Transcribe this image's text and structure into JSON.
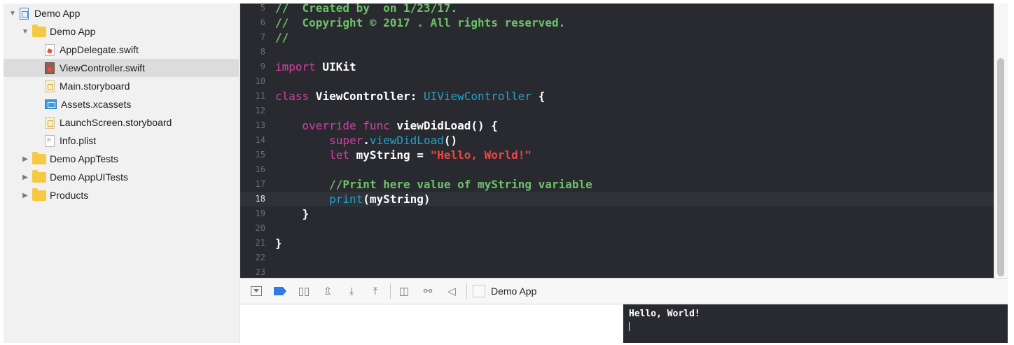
{
  "navigator": {
    "items": [
      {
        "label": "Demo App",
        "kind": "project",
        "disclosure": "▼",
        "indent": 0
      },
      {
        "label": "Demo App",
        "kind": "folder",
        "disclosure": "▼",
        "indent": 1
      },
      {
        "label": "AppDelegate.swift",
        "kind": "swift",
        "disclosure": "",
        "indent": 2
      },
      {
        "label": "ViewController.swift",
        "kind": "swift-selected",
        "disclosure": "",
        "indent": 2
      },
      {
        "label": "Main.storyboard",
        "kind": "storyboard",
        "disclosure": "",
        "indent": 2
      },
      {
        "label": "Assets.xcassets",
        "kind": "assets",
        "disclosure": "",
        "indent": 2
      },
      {
        "label": "LaunchScreen.storyboard",
        "kind": "storyboard",
        "disclosure": "",
        "indent": 2
      },
      {
        "label": "Info.plist",
        "kind": "plist",
        "disclosure": "",
        "indent": 2
      },
      {
        "label": "Demo AppTests",
        "kind": "folder",
        "disclosure": "▶",
        "indent": 1
      },
      {
        "label": "Demo AppUITests",
        "kind": "folder",
        "disclosure": "▶",
        "indent": 1
      },
      {
        "label": "Products",
        "kind": "folder",
        "disclosure": "▶",
        "indent": 1
      }
    ],
    "selected_label": "ViewController.swift"
  },
  "editor": {
    "current_line": "18",
    "lines": [
      {
        "num": "5",
        "tokens": [
          {
            "t": "//  Created by  on 1/23/17.",
            "c": "comment"
          }
        ]
      },
      {
        "num": "6",
        "tokens": [
          {
            "t": "//  Copyright © 2017 . All rights reserved.",
            "c": "comment"
          }
        ]
      },
      {
        "num": "7",
        "tokens": [
          {
            "t": "//",
            "c": "comment"
          }
        ]
      },
      {
        "num": "8",
        "tokens": []
      },
      {
        "num": "9",
        "tokens": [
          {
            "t": "import",
            "c": "keyword"
          },
          {
            "t": " UIKit",
            "c": "plain"
          }
        ]
      },
      {
        "num": "10",
        "tokens": []
      },
      {
        "num": "11",
        "tokens": [
          {
            "t": "class",
            "c": "keyword"
          },
          {
            "t": " ViewController: ",
            "c": "plain"
          },
          {
            "t": "UIViewController",
            "c": "type"
          },
          {
            "t": " {",
            "c": "plain"
          }
        ]
      },
      {
        "num": "12",
        "tokens": []
      },
      {
        "num": "13",
        "tokens": [
          {
            "t": "    ",
            "c": "plain"
          },
          {
            "t": "override",
            "c": "keyword"
          },
          {
            "t": " ",
            "c": "plain"
          },
          {
            "t": "func",
            "c": "keyword"
          },
          {
            "t": " viewDidLoad() {",
            "c": "plain"
          }
        ]
      },
      {
        "num": "14",
        "tokens": [
          {
            "t": "        ",
            "c": "plain"
          },
          {
            "t": "super",
            "c": "keyword"
          },
          {
            "t": ".",
            "c": "plain"
          },
          {
            "t": "viewDidLoad",
            "c": "type"
          },
          {
            "t": "()",
            "c": "plain"
          }
        ]
      },
      {
        "num": "15",
        "tokens": [
          {
            "t": "        ",
            "c": "plain"
          },
          {
            "t": "let",
            "c": "keyword"
          },
          {
            "t": " myString = ",
            "c": "plain"
          },
          {
            "t": "\"Hello, World!\"",
            "c": "string"
          }
        ]
      },
      {
        "num": "16",
        "tokens": []
      },
      {
        "num": "17",
        "tokens": [
          {
            "t": "        //Print here value of myString variable",
            "c": "comment"
          }
        ]
      },
      {
        "num": "18",
        "tokens": [
          {
            "t": "        ",
            "c": "plain"
          },
          {
            "t": "print",
            "c": "type"
          },
          {
            "t": "(myString)",
            "c": "plain"
          }
        ]
      },
      {
        "num": "19",
        "tokens": [
          {
            "t": "    }",
            "c": "plain"
          }
        ]
      },
      {
        "num": "20",
        "tokens": []
      },
      {
        "num": "21",
        "tokens": [
          {
            "t": "}",
            "c": "plain"
          }
        ]
      },
      {
        "num": "22",
        "tokens": []
      },
      {
        "num": "23",
        "tokens": []
      }
    ]
  },
  "debug_bar": {
    "buttons": [
      {
        "name": "hide-debug-area-button",
        "icon": "hide-debug-area-icon"
      },
      {
        "name": "breakpoints-toggle-button",
        "icon": "breakpoint-icon"
      },
      {
        "name": "pause-button",
        "icon": "pause-icon",
        "glyph": "▯▯"
      },
      {
        "name": "step-over-button",
        "icon": "step-over-icon",
        "glyph": "⇫"
      },
      {
        "name": "step-into-button",
        "icon": "step-into-icon",
        "glyph": "⤓"
      },
      {
        "name": "step-out-button",
        "icon": "step-out-icon",
        "glyph": "⤒"
      },
      {
        "name": "view-hierarchy-button",
        "icon": "view-hierarchy-icon",
        "glyph": "◫"
      },
      {
        "name": "memory-graph-button",
        "icon": "memory-graph-icon",
        "glyph": "⚯"
      },
      {
        "name": "simulate-location-button",
        "icon": "location-arrow-icon",
        "glyph": "◁"
      }
    ],
    "target_label": "Demo App"
  },
  "console": {
    "output": "Hello, World!"
  },
  "colors": {
    "editor_bg": "#292a30",
    "comment": "#6cc368",
    "keyword": "#d43fa3",
    "type": "#21a3c9",
    "string": "#f1453f",
    "breakpoint_accent": "#2f7ce8"
  }
}
